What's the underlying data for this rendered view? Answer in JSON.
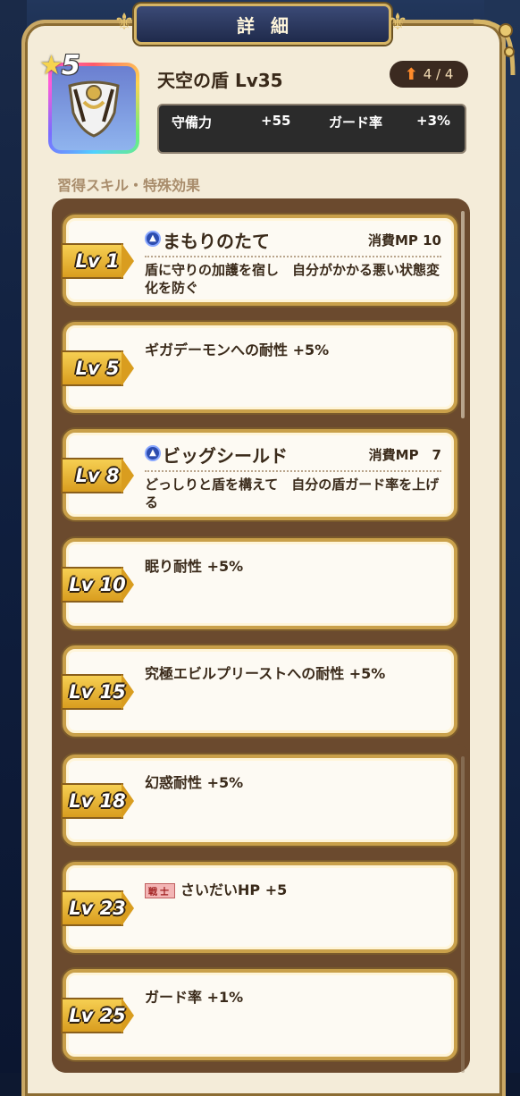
{
  "header": {
    "title": "詳細"
  },
  "item": {
    "rarity": "5",
    "name": "天空の盾 Lv35",
    "upgrade": "4 / 4",
    "stats": [
      {
        "label": "守備力",
        "value": "+55"
      },
      {
        "label": "ガード率",
        "value": "+3%"
      }
    ]
  },
  "section_title": "習得スキル・特殊効果",
  "skills": [
    {
      "level": "Lv 1",
      "name": "まもりのたて",
      "mp": "消費MP 10",
      "desc": "盾に守りの加護を宿し　自分がかかる悪い状態変化を防ぐ"
    },
    {
      "level": "Lv 5",
      "text": "ギガデーモンへの耐性 +5%"
    },
    {
      "level": "Lv 8",
      "name": "ビッグシールド",
      "mp": "消費MP　7",
      "desc": "どっしりと盾を構えて　自分の盾ガード率を上げる"
    },
    {
      "level": "Lv 10",
      "text": "眠り耐性 +5%"
    },
    {
      "level": "Lv 15",
      "text": "究極エビルプリーストへの耐性 +5%"
    },
    {
      "level": "Lv 18",
      "text": "幻惑耐性 +5%"
    },
    {
      "level": "Lv 23",
      "badge": "戦士",
      "text": "さいだいHP +5"
    },
    {
      "level": "Lv 25",
      "text": "ガード率 +1%"
    }
  ]
}
